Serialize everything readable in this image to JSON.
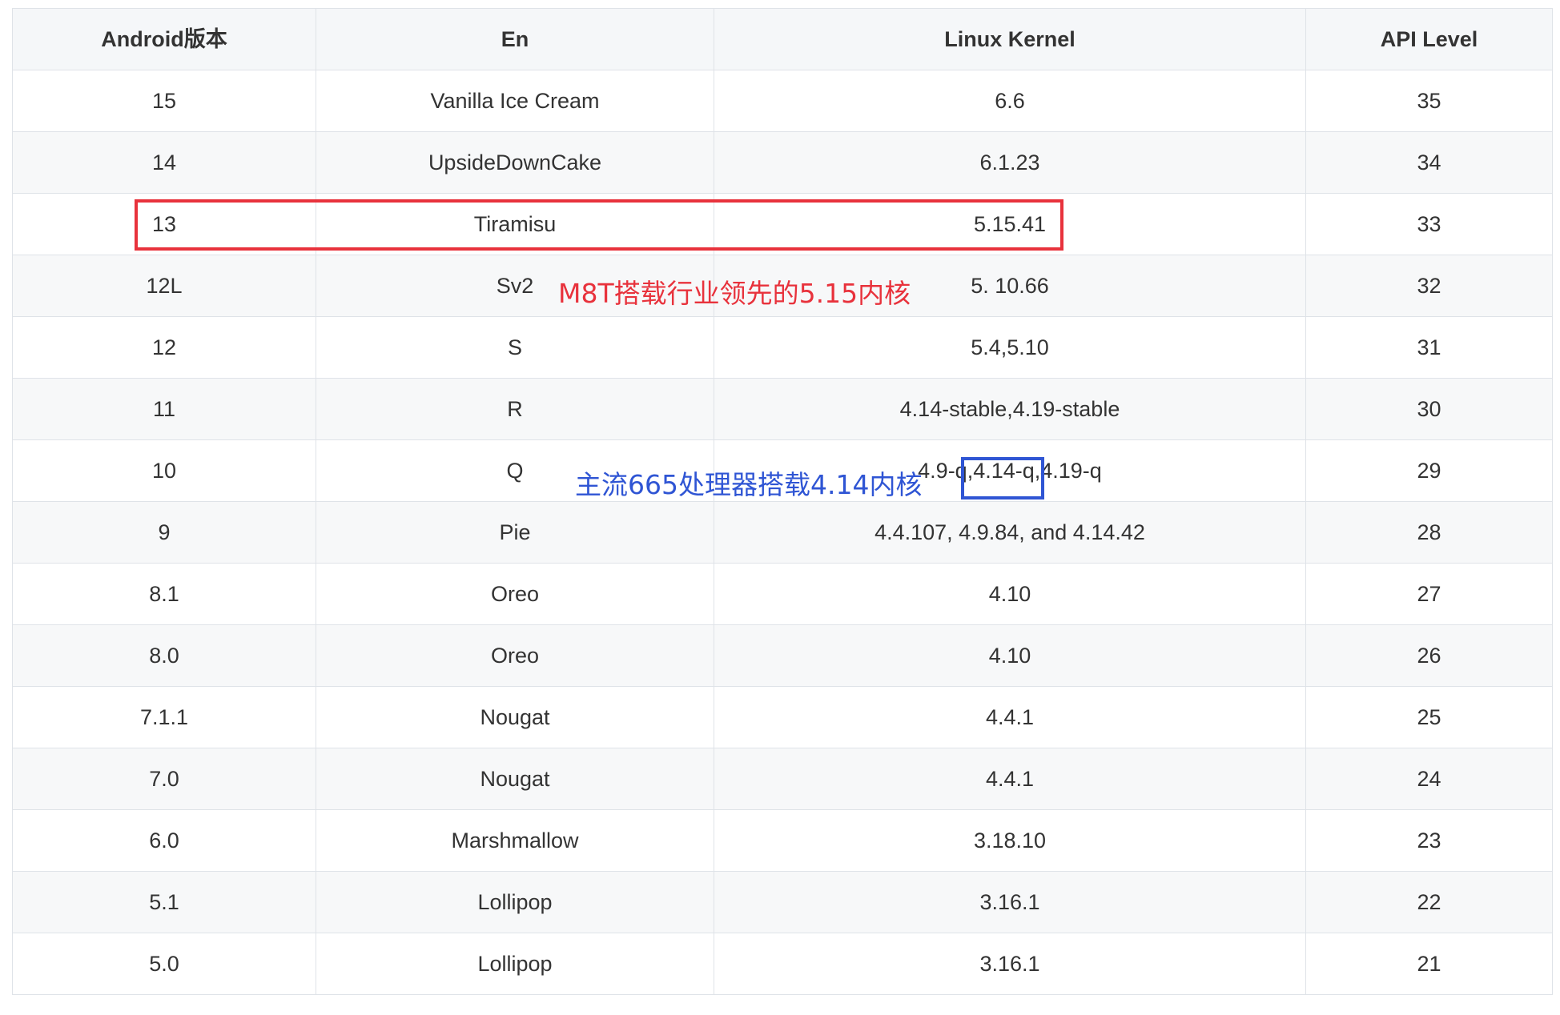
{
  "table": {
    "headers": [
      "Android版本",
      "En",
      "Linux Kernel",
      "API Level"
    ],
    "rows": [
      {
        "version": "15",
        "name": "Vanilla Ice Cream",
        "kernel": "6.6",
        "api": "35"
      },
      {
        "version": "14",
        "name": "UpsideDownCake",
        "kernel": "6.1.23",
        "api": "34"
      },
      {
        "version": "13",
        "name": "Tiramisu",
        "kernel": "5.15.41",
        "api": "33"
      },
      {
        "version": "12L",
        "name": "Sv2",
        "kernel": "5. 10.66",
        "api": "32"
      },
      {
        "version": "12",
        "name": "S",
        "kernel": "5.4,5.10",
        "api": "31"
      },
      {
        "version": "11",
        "name": "R",
        "kernel": "4.14-stable,4.19-stable",
        "api": "30"
      },
      {
        "version": "10",
        "name": "Q",
        "kernel": "4.9-q,4.14-q,4.19-q",
        "api": "29"
      },
      {
        "version": "9",
        "name": "Pie",
        "kernel": "4.4.107, 4.9.84, and 4.14.42",
        "api": "28"
      },
      {
        "version": "8.1",
        "name": "Oreo",
        "kernel": "4.10",
        "api": "27"
      },
      {
        "version": "8.0",
        "name": "Oreo",
        "kernel": "4.10",
        "api": "26"
      },
      {
        "version": "7.1.1",
        "name": "Nougat",
        "kernel": "4.4.1",
        "api": "25"
      },
      {
        "version": "7.0",
        "name": "Nougat",
        "kernel": "4.4.1",
        "api": "24"
      },
      {
        "version": "6.0",
        "name": "Marshmallow",
        "kernel": "3.18.10",
        "api": "23"
      },
      {
        "version": "5.1",
        "name": "Lollipop",
        "kernel": "3.16.1",
        "api": "22"
      },
      {
        "version": "5.0",
        "name": "Lollipop",
        "kernel": "3.16.1",
        "api": "21"
      }
    ]
  },
  "annotations": {
    "red_note": "M8T搭载行业领先的5.15内核",
    "blue_note": "主流665处理器搭载4.14内核",
    "red_color": "#e8323c",
    "blue_color": "#2f55d4"
  }
}
